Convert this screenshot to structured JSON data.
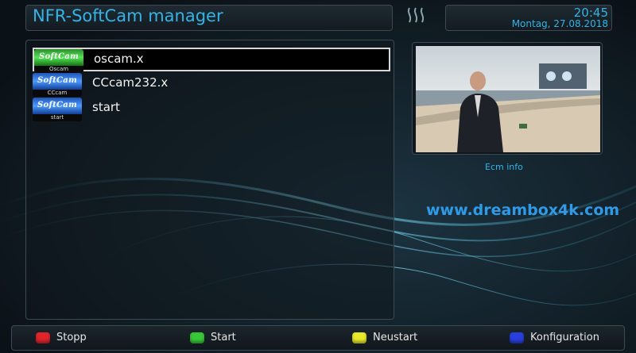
{
  "header": {
    "title": "NFR-SoftCam manager",
    "time": "20:45",
    "date": "Montag, 27.08.2018"
  },
  "cam_list": [
    {
      "icon_text": "SoftCam",
      "icon_sub": "Oscam",
      "label": "oscam.x",
      "icon_color": "green",
      "selected": true
    },
    {
      "icon_text": "SoftCam",
      "icon_sub": "CCcam",
      "label": "CCcam232.x",
      "icon_color": "blue",
      "selected": false
    },
    {
      "icon_text": "SoftCam",
      "icon_sub": "start",
      "label": "start",
      "icon_color": "blue",
      "selected": false
    }
  ],
  "preview": {
    "caption": "Ecm info"
  },
  "watermark": "www.dreambox4k.com",
  "footer": {
    "red": "Stopp",
    "green": "Start",
    "yellow": "Neustart",
    "blue": "Konfiguration"
  },
  "colors": {
    "accent": "#33b3e6",
    "red": "#e0242a",
    "green": "#37c837",
    "yellow": "#e9e92a",
    "blue": "#2a3fe0"
  }
}
